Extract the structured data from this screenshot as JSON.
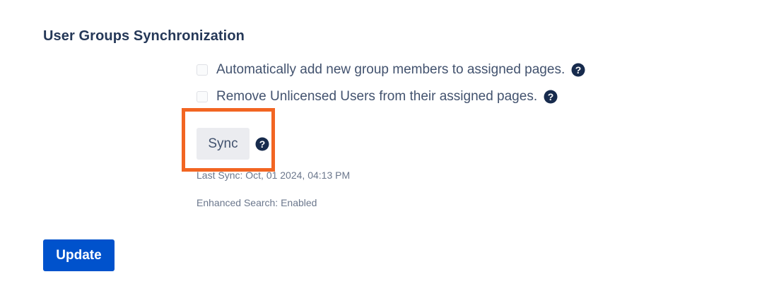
{
  "section": {
    "title": "User Groups Synchronization"
  },
  "options": [
    {
      "label": "Automatically add new group members to assigned pages.",
      "checked": false,
      "help_icon": "question-circle-icon"
    },
    {
      "label": "Remove Unlicensed Users from their assigned pages.",
      "checked": false,
      "help_icon": "question-circle-icon"
    }
  ],
  "sync": {
    "button_label": "Sync",
    "help_icon": "question-circle-icon",
    "last_sync": "Last Sync: Oct, 01 2024, 04:13 PM",
    "enhanced_search": "Enhanced Search: Enabled"
  },
  "actions": {
    "update_label": "Update"
  },
  "colors": {
    "primary": "#0052cc",
    "highlight": "#f26522",
    "title_text": "#253858",
    "body_text": "#42526e",
    "muted_text": "#6b778c",
    "help_icon": "#172b4d"
  }
}
